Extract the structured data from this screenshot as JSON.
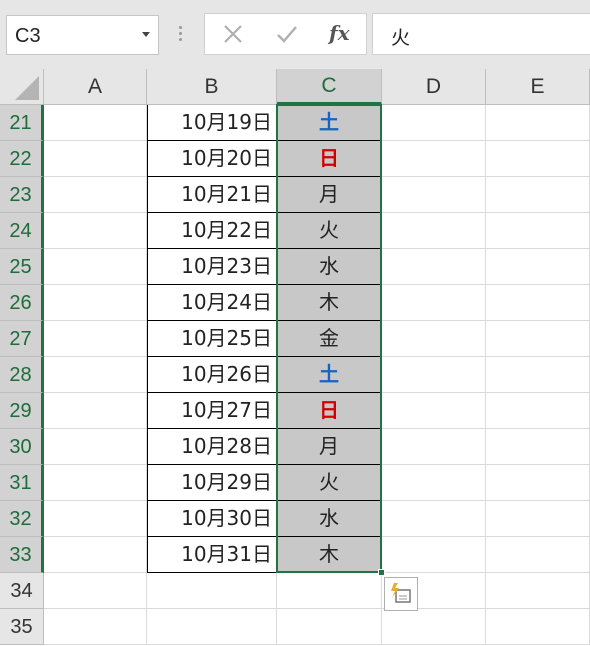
{
  "formula_bar": {
    "name_box": "C3",
    "cancel_icon": "cancel-icon",
    "enter_icon": "check-icon",
    "function_label": "fx",
    "formula_value": "火"
  },
  "columns": [
    "A",
    "B",
    "C",
    "D",
    "E"
  ],
  "selected_column": "C",
  "rows": [
    {
      "num": "21",
      "b": "10月19日",
      "c": "土"
    },
    {
      "num": "22",
      "b": "10月20日",
      "c": "日"
    },
    {
      "num": "23",
      "b": "10月21日",
      "c": "月"
    },
    {
      "num": "24",
      "b": "10月22日",
      "c": "火"
    },
    {
      "num": "25",
      "b": "10月23日",
      "c": "水"
    },
    {
      "num": "26",
      "b": "10月24日",
      "c": "木"
    },
    {
      "num": "27",
      "b": "10月25日",
      "c": "金"
    },
    {
      "num": "28",
      "b": "10月26日",
      "c": "土"
    },
    {
      "num": "29",
      "b": "10月27日",
      "c": "日"
    },
    {
      "num": "30",
      "b": "10月28日",
      "c": "月"
    },
    {
      "num": "31",
      "b": "10月29日",
      "c": "火"
    },
    {
      "num": "32",
      "b": "10月30日",
      "c": "水"
    },
    {
      "num": "33",
      "b": "10月31日",
      "c": "木"
    },
    {
      "num": "34",
      "b": "",
      "c": ""
    },
    {
      "num": "35",
      "b": "",
      "c": ""
    }
  ],
  "colors": {
    "saturday": "#1565c0",
    "sunday": "#d40000",
    "selection": "#217346"
  },
  "quick_analysis_icon": "quick-analysis-icon"
}
